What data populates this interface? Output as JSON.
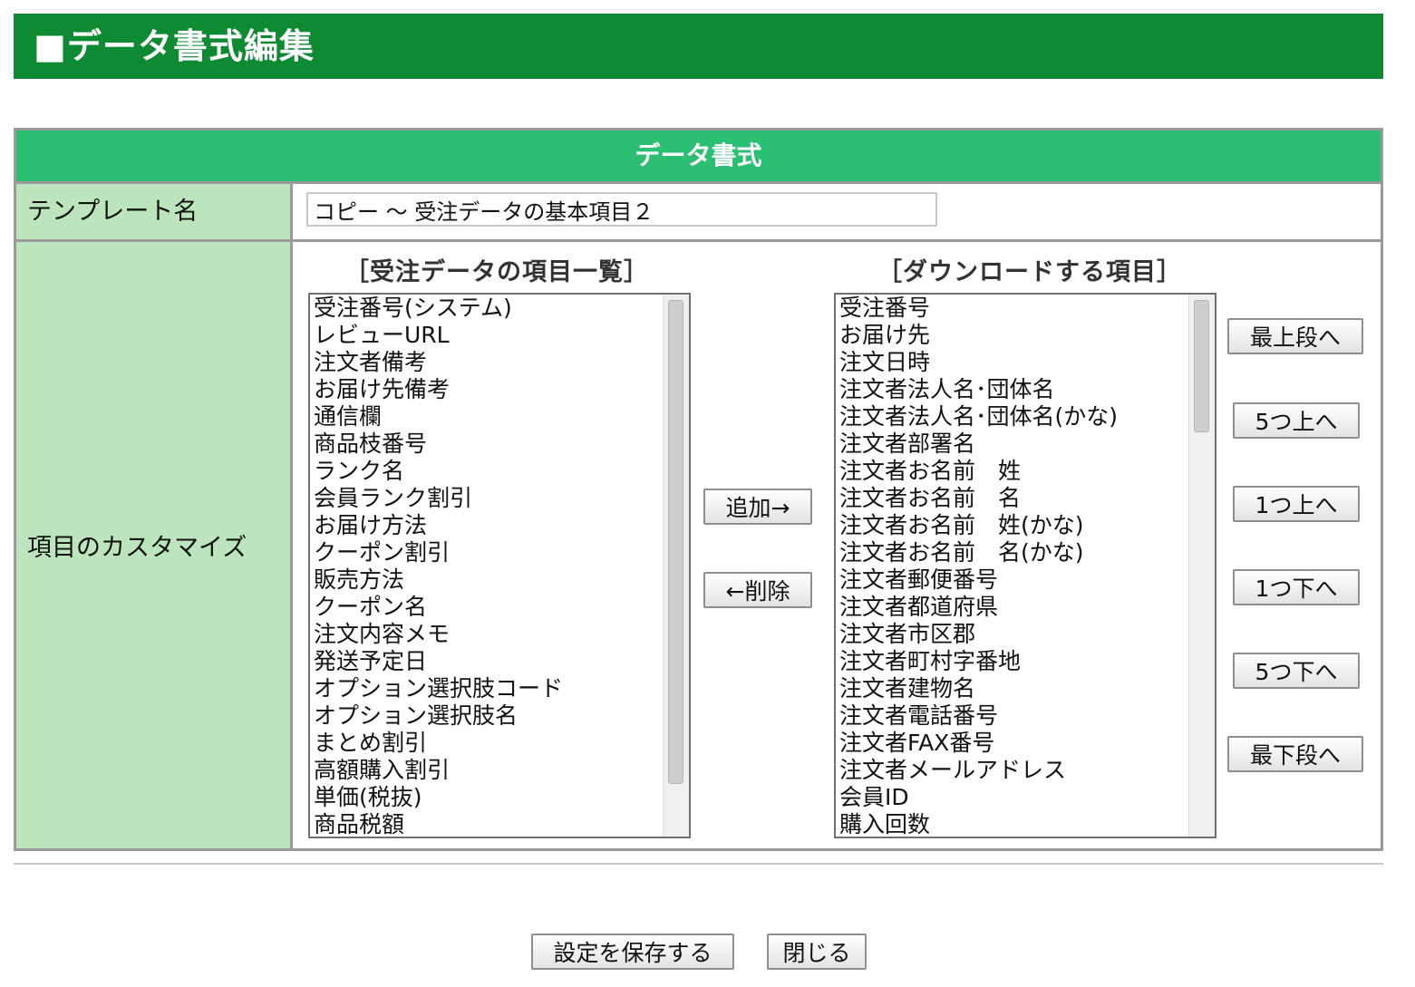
{
  "header": {
    "title": "■データ書式編集"
  },
  "section": {
    "title": "データ書式"
  },
  "template": {
    "label": "テンプレート名",
    "value": "コピー ～ 受注データの基本項目２"
  },
  "customize": {
    "label": "項目のカスタマイズ",
    "available": {
      "heading": "［受注データの項目一覧］",
      "items": [
        "受注番号(システム)",
        "レビューURL",
        "注文者備考",
        "お届け先備考",
        "通信欄",
        "商品枝番号",
        "ランク名",
        "会員ランク割引",
        "お届け方法",
        "クーポン割引",
        "販売方法",
        "クーポン名",
        "注文内容メモ",
        "発送予定日",
        "オプション選択肢コード",
        "オプション選択肢名",
        "まとめ割引",
        "高額購入割引",
        "単価(税抜)",
        "商品税額"
      ]
    },
    "selected": {
      "heading": "［ダウンロードする項目］",
      "items": [
        "受注番号",
        "お届け先",
        "注文日時",
        "注文者法人名･団体名",
        "注文者法人名･団体名(かな)",
        "注文者部署名",
        "注文者お名前　姓",
        "注文者お名前　名",
        "注文者お名前　姓(かな)",
        "注文者お名前　名(かな)",
        "注文者郵便番号",
        "注文者都道府県",
        "注文者市区郡",
        "注文者町村字番地",
        "注文者建物名",
        "注文者電話番号",
        "注文者FAX番号",
        "注文者メールアドレス",
        "会員ID",
        "購入回数"
      ]
    },
    "add_label": "追加→",
    "remove_label": "←削除",
    "order": {
      "top": "最上段へ",
      "up5": "5つ上へ",
      "up1": "1つ上へ",
      "down1": "1つ下へ",
      "down5": "5つ下へ",
      "bottom": "最下段へ"
    }
  },
  "footer": {
    "save_label": "設定を保存する",
    "close_label": "閉じる"
  }
}
